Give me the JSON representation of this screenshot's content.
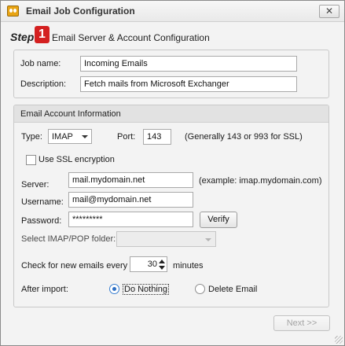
{
  "window": {
    "title": "Email Job Configuration",
    "close_glyph": "✕",
    "icons": {
      "app": "app-logo-icon",
      "close": "close-icon"
    }
  },
  "step": {
    "word": "Step",
    "number": "1",
    "title": "Email Server & Account Configuration",
    "colors": {
      "badge": "#d42020"
    }
  },
  "job": {
    "name_label": "Job name:",
    "name_value": "Incoming Emails",
    "description_label": "Description:",
    "description_value": "Fetch mails from Microsoft Exchanger"
  },
  "account": {
    "header": "Email Account Information",
    "type_label": "Type:",
    "type_value": "IMAP",
    "port_label": "Port:",
    "port_value": "143",
    "port_hint": "(Generally 143 or 993 for SSL)",
    "ssl_label": "Use SSL encryption",
    "ssl_checked": false,
    "server_label": "Server:",
    "server_value": "mail.mydomain.net",
    "server_hint": "(example: imap.mydomain.com)",
    "username_label": "Username:",
    "username_value": "mail@mydomain.net",
    "password_label": "Password:",
    "password_value": "*********",
    "verify_label": "Verify",
    "folder_label": "Select IMAP/POP folder:",
    "folder_value": "",
    "check_label": "Check for new emails every",
    "check_value": "30",
    "check_unit": "minutes",
    "after_import_label": "After import:",
    "option_do_nothing": "Do Nothing",
    "option_delete": "Delete Email",
    "selected_option": "Do Nothing"
  },
  "footer": {
    "next_label": "Next >>",
    "next_enabled": false
  }
}
